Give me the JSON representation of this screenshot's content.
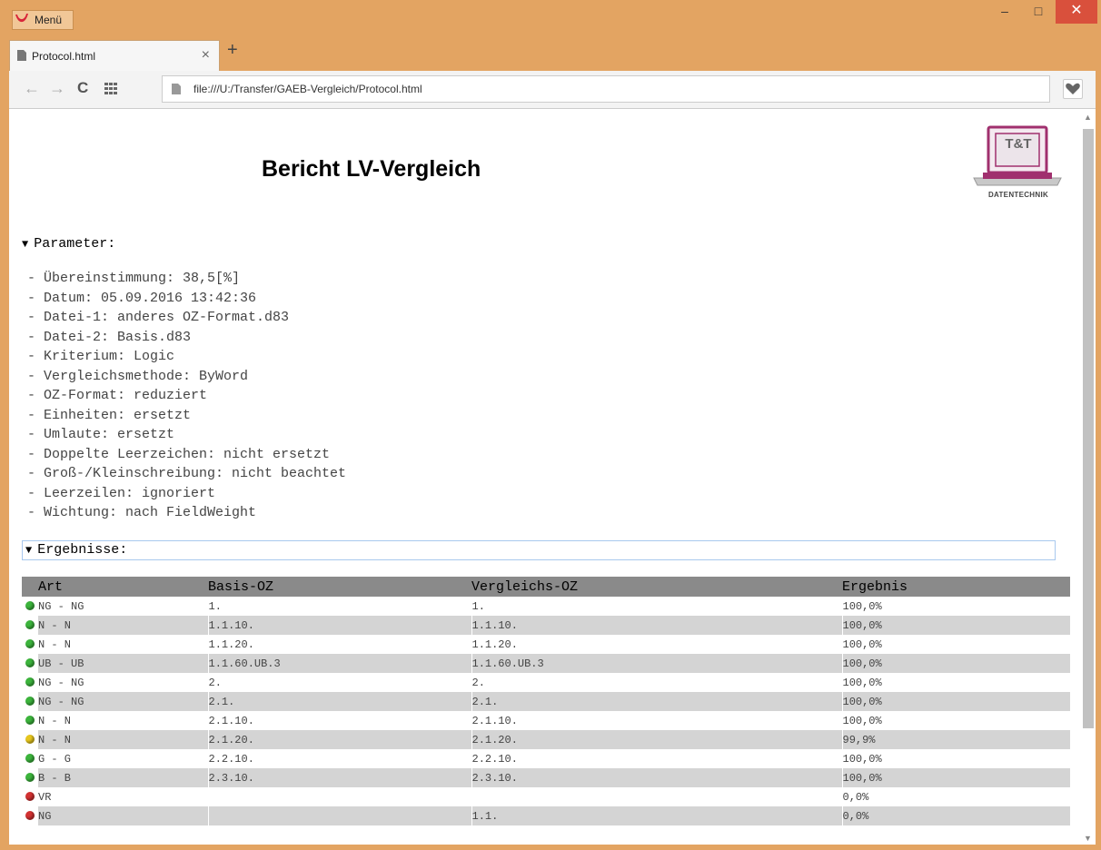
{
  "window": {
    "menu_label": "Menü",
    "minimize": "–",
    "maximize": "□",
    "close": "✕"
  },
  "tab": {
    "title": "Protocol.html",
    "close": "×",
    "new_tab": "+"
  },
  "toolbar": {
    "url": "file:///U:/Transfer/GAEB-Vergleich/Protocol.html",
    "back": "←",
    "forward": "→",
    "reload": "C"
  },
  "page": {
    "title": "Bericht LV-Vergleich",
    "logo_text": "T&T",
    "logo_caption": "DATENTECHNIK",
    "params_heading": "Parameter:",
    "params": [
      "- Übereinstimmung: 38,5[%]",
      "- Datum: 05.09.2016 13:42:36",
      "- Datei-1: anderes OZ-Format.d83",
      "- Datei-2: Basis.d83",
      "- Kriterium: Logic",
      "- Vergleichsmethode: ByWord",
      "- OZ-Format: reduziert",
      "- Einheiten: ersetzt",
      "- Umlaute: ersetzt",
      "- Doppelte Leerzeichen: nicht ersetzt",
      "- Groß-/Kleinschreibung: nicht beachtet",
      "- Leerzeilen: ignoriert",
      "- Wichtung: nach FieldWeight"
    ],
    "results_heading": "Ergebnisse:",
    "results_columns": [
      "Art",
      "Basis-OZ",
      "Vergleichs-OZ",
      "Ergebnis"
    ],
    "results_rows": [
      {
        "status": "green",
        "art": "NG - NG",
        "basis": "1.",
        "vgl": "1.",
        "ergebnis": "100,0%"
      },
      {
        "status": "green",
        "art": "N - N",
        "basis": "1.1.10.",
        "vgl": "1.1.10.",
        "ergebnis": "100,0%"
      },
      {
        "status": "green",
        "art": "N - N",
        "basis": "1.1.20.",
        "vgl": "1.1.20.",
        "ergebnis": "100,0%"
      },
      {
        "status": "green",
        "art": "UB - UB",
        "basis": "1.1.60.UB.3",
        "vgl": "1.1.60.UB.3",
        "ergebnis": "100,0%"
      },
      {
        "status": "green",
        "art": "NG - NG",
        "basis": "2.",
        "vgl": "2.",
        "ergebnis": "100,0%"
      },
      {
        "status": "green",
        "art": "NG - NG",
        "basis": "2.1.",
        "vgl": "2.1.",
        "ergebnis": "100,0%"
      },
      {
        "status": "green",
        "art": "N - N",
        "basis": "2.1.10.",
        "vgl": "2.1.10.",
        "ergebnis": "100,0%"
      },
      {
        "status": "yellow",
        "art": "N - N",
        "basis": "2.1.20.",
        "vgl": "2.1.20.",
        "ergebnis": "99,9%"
      },
      {
        "status": "green",
        "art": "G - G",
        "basis": "2.2.10.",
        "vgl": "2.2.10.",
        "ergebnis": "100,0%"
      },
      {
        "status": "green",
        "art": "B - B",
        "basis": "2.3.10.",
        "vgl": "2.3.10.",
        "ergebnis": "100,0%"
      },
      {
        "status": "red",
        "art": "VR",
        "basis": "",
        "vgl": "",
        "ergebnis": "0,0%"
      },
      {
        "status": "red",
        "art": "NG",
        "basis": "",
        "vgl": "1.1.",
        "ergebnis": "0,0%"
      }
    ]
  },
  "colors": {
    "chrome": "#e3a462",
    "green": "#3cb43c",
    "yellow": "#e6c61e",
    "red": "#d23232",
    "logo_magenta": "#a0306e"
  }
}
